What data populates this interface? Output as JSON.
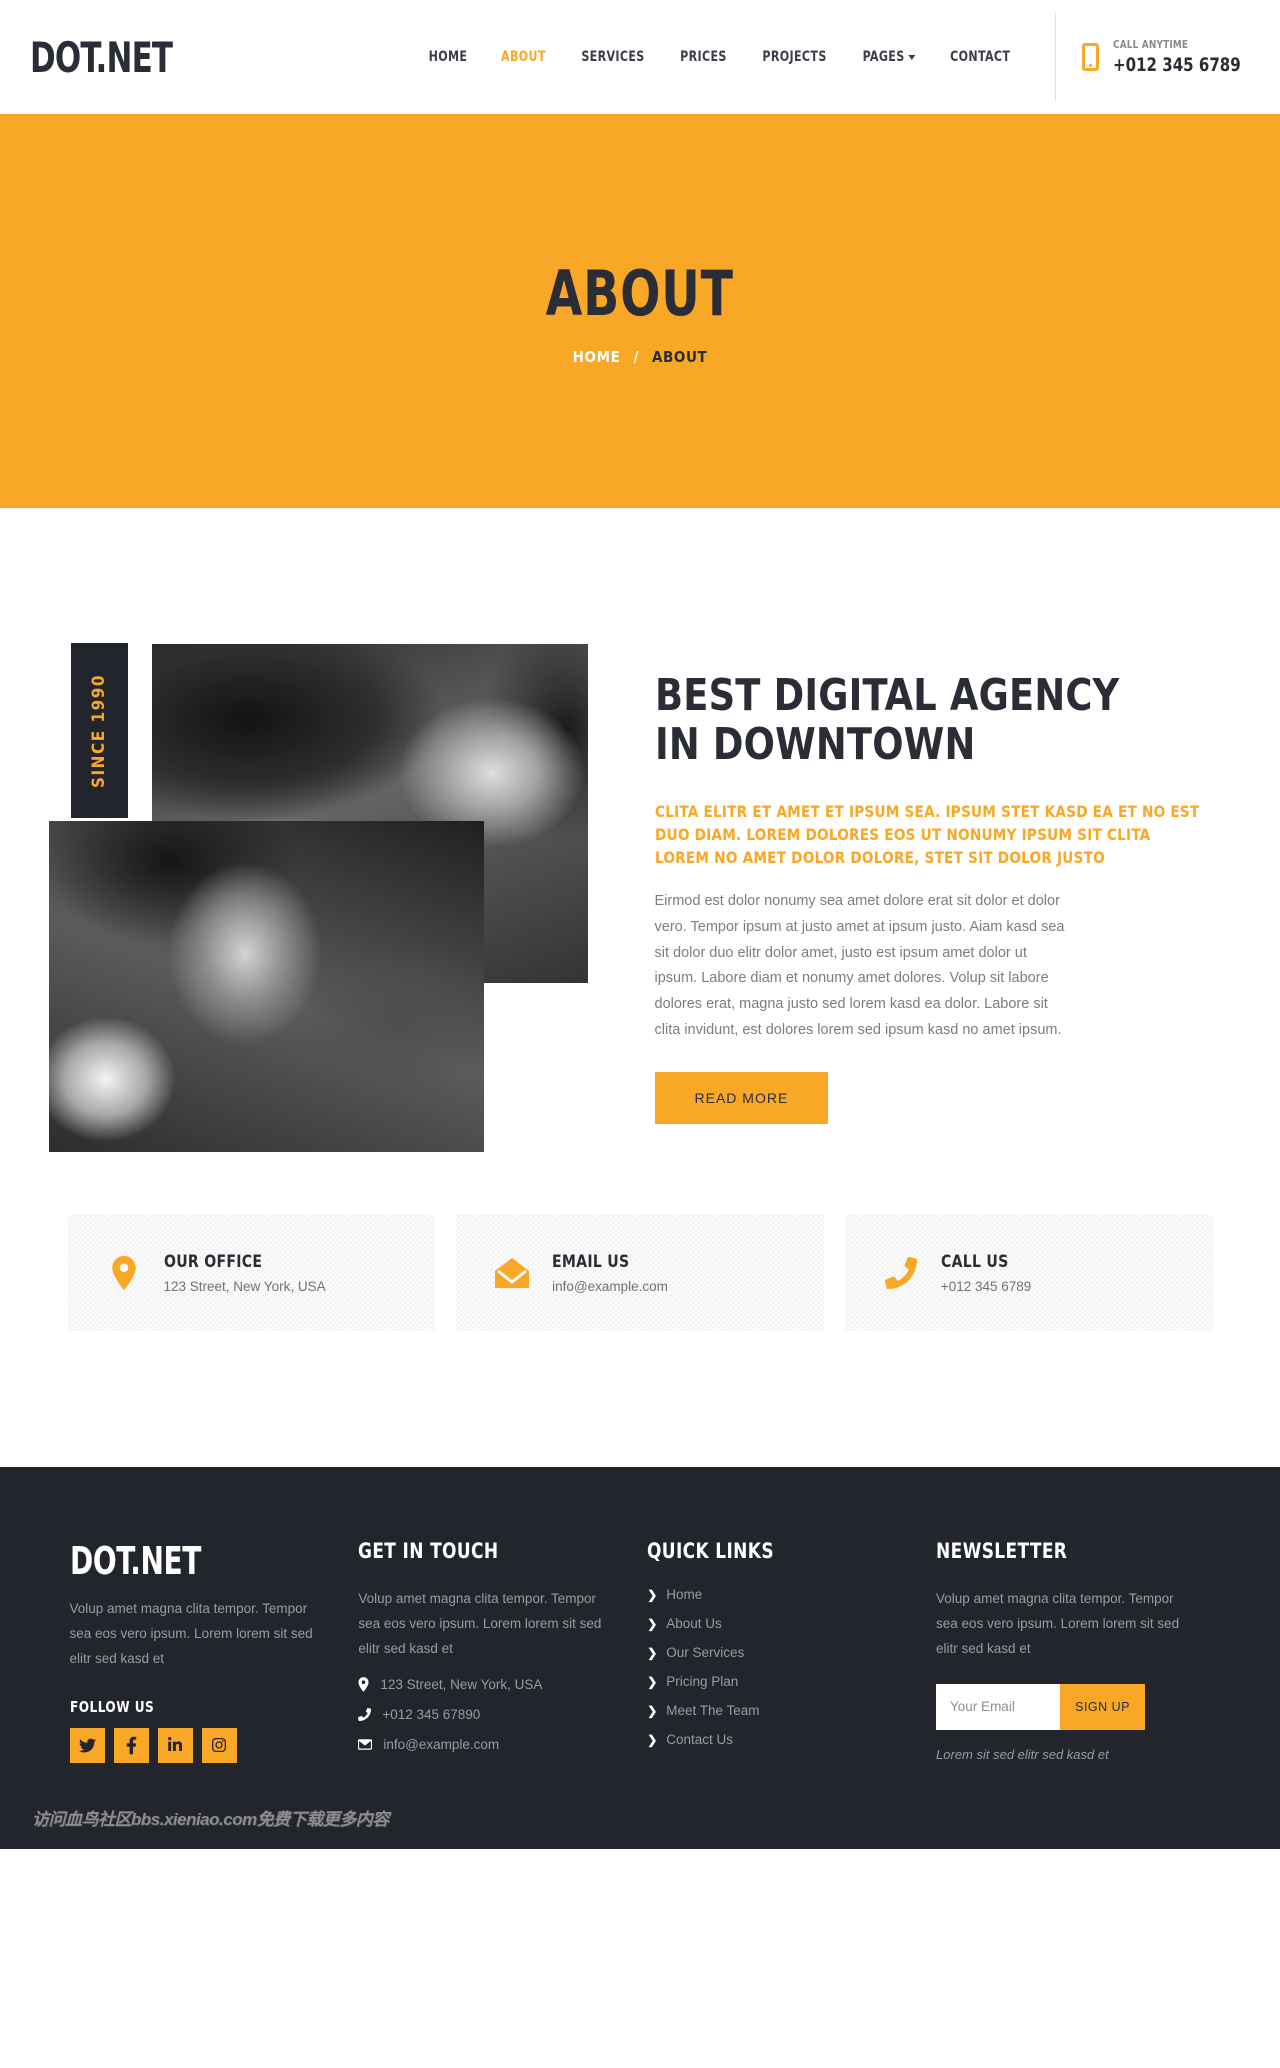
{
  "header": {
    "brand": "DOT.NET",
    "nav": [
      {
        "label": "HOME",
        "active": false
      },
      {
        "label": "ABOUT",
        "active": true
      },
      {
        "label": "SERVICES",
        "active": false
      },
      {
        "label": "PRICES",
        "active": false
      },
      {
        "label": "PROJECTS",
        "active": false
      },
      {
        "label": "PAGES",
        "active": false,
        "dropdown": true
      },
      {
        "label": "CONTACT",
        "active": false
      }
    ],
    "call_label": "CALL ANYTIME",
    "call_number": "+012 345 6789"
  },
  "pagehead": {
    "title": "ABOUT",
    "crumb_home": "HOME",
    "crumb_sep": "/",
    "crumb_current": "ABOUT"
  },
  "about": {
    "since_badge": "SINCE 1990",
    "heading_line1": "BEST DIGITAL AGENCY",
    "heading_line2": "IN DOWNTOWN",
    "lead": "CLITA ELITR ET AMET ET IPSUM SEA. IPSUM STET KASD EA ET NO EST DUO DIAM. LOREM DOLORES EOS UT NONUMY IPSUM SIT CLITA LOREM NO AMET DOLOR DOLORE, STET SIT DOLOR JUSTO",
    "body": "Eirmod est dolor nonumy sea amet dolore erat sit dolor et dolor vero. Tempor ipsum at justo amet at ipsum justo. Aiam kasd sea sit dolor duo elitr dolor amet, justo est ipsum amet dolor ut ipsum. Labore diam et nonumy amet dolores. Volup sit labore dolores erat, magna justo sed lorem kasd ea dolor. Labore sit clita invidunt, est dolores lorem sed ipsum kasd no amet ipsum.",
    "read_more": "READ MORE"
  },
  "cards": [
    {
      "icon": "map-pin-icon",
      "title": "OUR OFFICE",
      "text": "123 Street, New York, USA"
    },
    {
      "icon": "envelope-icon",
      "title": "EMAIL US",
      "text": "info@example.com"
    },
    {
      "icon": "phone-icon",
      "title": "CALL US",
      "text": "+012 345 6789"
    }
  ],
  "footer": {
    "brand": "DOT.NET",
    "brand_text": "Volup amet magna clita tempor. Tempor sea eos vero ipsum. Lorem lorem sit sed elitr sed kasd et",
    "follow_label": "FOLLOW US",
    "socials": [
      {
        "name": "twitter-icon"
      },
      {
        "name": "facebook-icon"
      },
      {
        "name": "linkedin-icon"
      },
      {
        "name": "instagram-icon"
      }
    ],
    "touch_title": "GET IN TOUCH",
    "touch_text": "Volup amet magna clita tempor. Tempor sea eos vero ipsum. Lorem lorem sit sed elitr sed kasd et",
    "touch_address": "123 Street, New York, USA",
    "touch_phone": "+012 345 67890",
    "touch_email": "info@example.com",
    "links_title": "QUICK LINKS",
    "links": [
      {
        "label": "Home"
      },
      {
        "label": "About Us"
      },
      {
        "label": "Our Services"
      },
      {
        "label": "Pricing Plan"
      },
      {
        "label": "Meet The Team"
      },
      {
        "label": "Contact Us"
      }
    ],
    "news_title": "NEWSLETTER",
    "news_text": "Volup amet magna clita tempor. Tempor sea eos vero ipsum. Lorem lorem sit sed elitr sed kasd et",
    "news_placeholder": "Your Email",
    "news_button": "SIGN UP",
    "news_note": "Lorem sit sed elitr sed kasd et"
  },
  "watermark": "访问血鸟社区bbs.xieniao.com免费下载更多内容",
  "colors": {
    "accent": "#f9a726",
    "dark": "#23252d",
    "text": "#2b2d36",
    "muted": "#9a9ba1"
  }
}
